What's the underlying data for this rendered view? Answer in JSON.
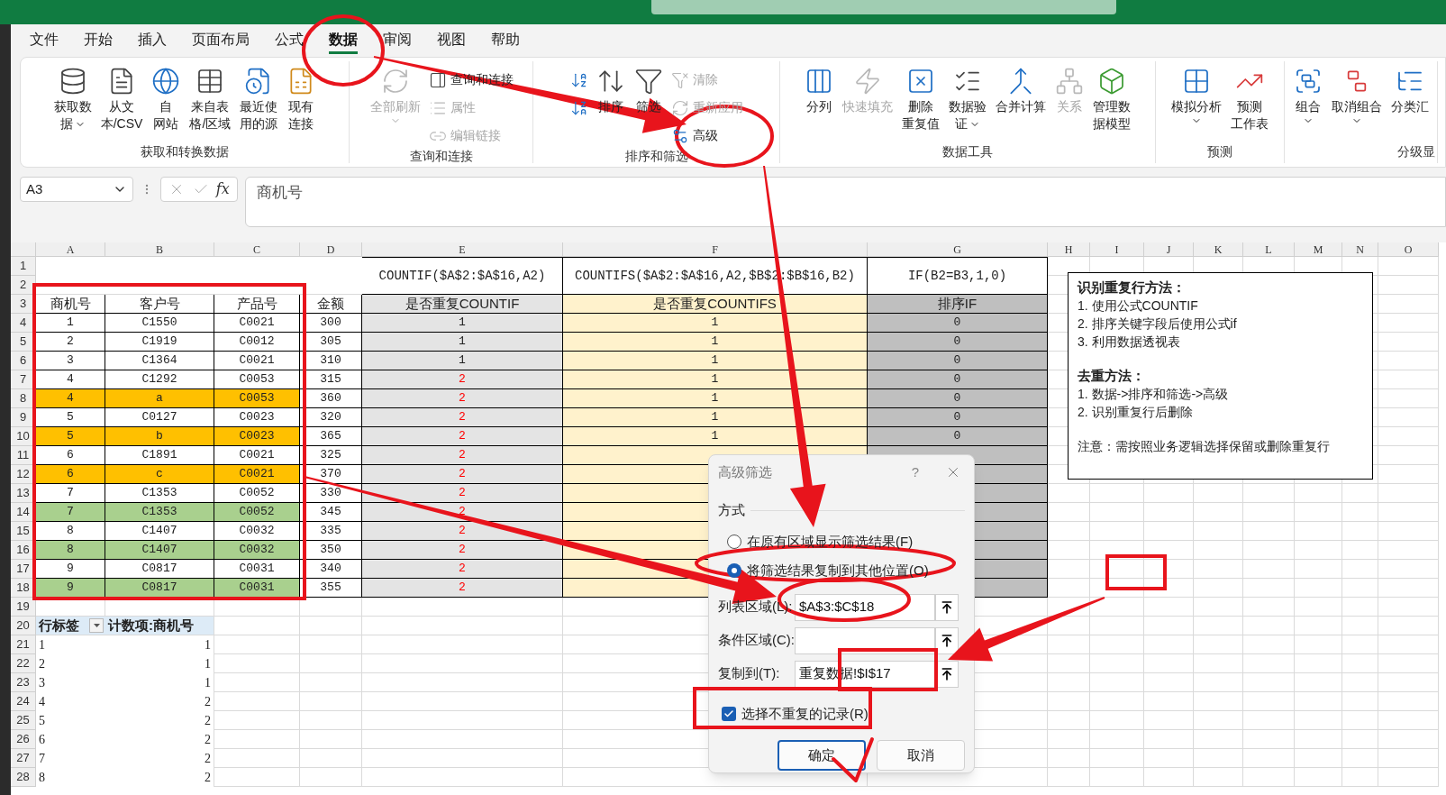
{
  "ribbon": {
    "tabs": [
      {
        "label": "文件",
        "selected": false
      },
      {
        "label": "开始",
        "selected": false
      },
      {
        "label": "插入",
        "selected": false
      },
      {
        "label": "页面布局",
        "selected": false
      },
      {
        "label": "公式",
        "selected": false
      },
      {
        "label": "数据",
        "selected": true
      },
      {
        "label": "审阅",
        "selected": false
      },
      {
        "label": "视图",
        "selected": false
      },
      {
        "label": "帮助",
        "selected": false
      }
    ],
    "groups": [
      {
        "label": "获取和转换数据",
        "items": [
          {
            "kind": "large",
            "lines": [
              "获取数",
              "据"
            ],
            "dropdown": true,
            "disabled": false
          },
          {
            "kind": "large",
            "lines": [
              "从文",
              "本/CSV"
            ],
            "disabled": false
          },
          {
            "kind": "large",
            "lines": [
              "自",
              "网站"
            ],
            "disabled": false
          },
          {
            "kind": "large",
            "lines": [
              "来自表",
              "格/区域"
            ],
            "disabled": false
          },
          {
            "kind": "large",
            "lines": [
              "最近使",
              "用的源"
            ],
            "disabled": false
          },
          {
            "kind": "large",
            "lines": [
              "现有",
              "连接"
            ],
            "disabled": false
          }
        ]
      },
      {
        "label": "查询和连接",
        "items": [
          {
            "kind": "large",
            "lines": [
              "全部刷新"
            ],
            "dropdown": true,
            "disabled": true
          },
          {
            "kind": "stack",
            "items": [
              {
                "label": "查询和连接",
                "disabled": false
              },
              {
                "label": "属性",
                "disabled": true
              },
              {
                "label": "编辑链接",
                "disabled": true
              }
            ]
          }
        ]
      },
      {
        "label": "排序和筛选",
        "items": [
          {
            "kind": "stack",
            "items": [
              {
                "disabled": false
              },
              {
                "disabled": false
              }
            ]
          },
          {
            "kind": "large",
            "lines": [
              "排序"
            ],
            "disabled": false
          },
          {
            "kind": "large",
            "lines": [
              "筛选"
            ],
            "disabled": false
          },
          {
            "kind": "stack",
            "items": [
              {
                "label": "清除",
                "disabled": true
              },
              {
                "label": "重新应用",
                "disabled": true
              },
              {
                "label": "高级",
                "disabled": false
              }
            ]
          }
        ]
      },
      {
        "label": "数据工具",
        "items": [
          {
            "kind": "large",
            "lines": [
              "分列"
            ],
            "disabled": false
          },
          {
            "kind": "large",
            "lines": [
              "快速填充"
            ],
            "disabled": true
          },
          {
            "kind": "large",
            "lines": [
              "删除",
              "重复值"
            ],
            "disabled": false
          },
          {
            "kind": "large",
            "lines": [
              "数据验",
              "证"
            ],
            "dropdown": true,
            "disabled": false
          },
          {
            "kind": "large",
            "lines": [
              "合并计算"
            ],
            "disabled": false
          },
          {
            "kind": "large",
            "lines": [
              "关系"
            ],
            "disabled": true
          },
          {
            "kind": "large",
            "lines": [
              "管理数",
              "据模型"
            ],
            "disabled": false
          }
        ]
      },
      {
        "label": "预测",
        "items": [
          {
            "kind": "large",
            "lines": [
              "模拟分析"
            ],
            "dropdown": true,
            "disabled": false
          },
          {
            "kind": "large",
            "lines": [
              "预测",
              "工作表"
            ],
            "disabled": false
          }
        ]
      },
      {
        "label": "分级显",
        "items": [
          {
            "kind": "large",
            "lines": [
              "组合"
            ],
            "dropdown": true,
            "disabled": false
          },
          {
            "kind": "large",
            "lines": [
              "取消组合"
            ],
            "dropdown": true,
            "disabled": false
          },
          {
            "kind": "large",
            "lines": [
              "分类汇"
            ],
            "disabled": false
          }
        ]
      }
    ]
  },
  "formula_bar": {
    "name_box": "A3",
    "fx": "fx",
    "formula": "商机号"
  },
  "sheet": {
    "columns": [
      "A",
      "B",
      "C",
      "D",
      "E",
      "F",
      "G",
      "H",
      "I",
      "J",
      "K",
      "L",
      "M",
      "N",
      "O"
    ],
    "row_numbers": [
      "1",
      "2",
      "3",
      "4",
      "5",
      "6",
      "7",
      "8",
      "9",
      "10",
      "11",
      "12",
      "13",
      "14",
      "15",
      "16",
      "17",
      "18",
      "19",
      "20",
      "21",
      "22",
      "23",
      "24",
      "25",
      "26",
      "27",
      "28"
    ],
    "formulas": [
      "COUNTIF($A$2:$A$16,A2)",
      "COUNTIFS($A$2:$A$16,A2,$B$2:$B$16,B2)",
      "IF(B2=B3,1,0)"
    ],
    "headers": [
      "商机号",
      "客户号",
      "产品号",
      "金额",
      "是否重复COUNTIF",
      "是否重复COUNTIFS",
      "排序IF"
    ],
    "rows": [
      {
        "a": "1",
        "b": "C1550",
        "c": "C0021",
        "d": "300",
        "e": "1",
        "f": "1",
        "g": "0",
        "flagged": false
      },
      {
        "a": "2",
        "b": "C1919",
        "c": "C0012",
        "d": "305",
        "e": "1",
        "f": "1",
        "g": "0",
        "flagged": false
      },
      {
        "a": "3",
        "b": "C1364",
        "c": "C0021",
        "d": "310",
        "e": "1",
        "f": "1",
        "g": "0",
        "flagged": false
      },
      {
        "a": "4",
        "b": "C1292",
        "c": "C0053",
        "d": "315",
        "e": "2",
        "f": "1",
        "g": "0",
        "flagged": true
      },
      {
        "a": "4",
        "b": "a",
        "c": "C0053",
        "d": "360",
        "e": "2",
        "f": "1",
        "g": "0",
        "flagged": true,
        "color": "#ffc000"
      },
      {
        "a": "5",
        "b": "C0127",
        "c": "C0023",
        "d": "320",
        "e": "2",
        "f": "1",
        "g": "0",
        "flagged": true
      },
      {
        "a": "5",
        "b": "b",
        "c": "C0023",
        "d": "365",
        "e": "2",
        "f": "1",
        "g": "0",
        "flagged": true,
        "color": "#ffc000"
      },
      {
        "a": "6",
        "b": "C1891",
        "c": "C0021",
        "d": "325",
        "e": "2",
        "flagged": true
      },
      {
        "a": "6",
        "b": "c",
        "c": "C0021",
        "d": "370",
        "e": "2",
        "flagged": true,
        "color": "#ffc000"
      },
      {
        "a": "7",
        "b": "C1353",
        "c": "C0052",
        "d": "330",
        "e": "2",
        "flagged": true
      },
      {
        "a": "7",
        "b": "C1353",
        "c": "C0052",
        "d": "345",
        "e": "2",
        "flagged": true,
        "color": "#a9d08e"
      },
      {
        "a": "8",
        "b": "C1407",
        "c": "C0032",
        "d": "335",
        "e": "2",
        "flagged": true
      },
      {
        "a": "8",
        "b": "C1407",
        "c": "C0032",
        "d": "350",
        "e": "2",
        "flagged": true,
        "color": "#a9d08e"
      },
      {
        "a": "9",
        "b": "C0817",
        "c": "C0031",
        "d": "340",
        "e": "2",
        "flagged": true
      },
      {
        "a": "9",
        "b": "C0817",
        "c": "C0031",
        "d": "355",
        "e": "2",
        "flagged": true,
        "color": "#a9d08e"
      }
    ],
    "pivot": {
      "header": [
        "行标签",
        "计数项:商机号"
      ],
      "rows": [
        {
          "label": "1",
          "count": "1"
        },
        {
          "label": "2",
          "count": "1"
        },
        {
          "label": "3",
          "count": "1"
        },
        {
          "label": "4",
          "count": "2"
        },
        {
          "label": "5",
          "count": "2"
        },
        {
          "label": "6",
          "count": "2"
        },
        {
          "label": "7",
          "count": "2"
        },
        {
          "label": "8",
          "count": "2"
        }
      ]
    }
  },
  "notes": [
    {
      "heading": "识别重复行方法：",
      "lines": [
        "1. 使用公式COUNTIF",
        "2. 排序关键字段后使用公式if",
        "3. 利用数据透视表"
      ]
    },
    {
      "heading": "去重方法：",
      "lines": [
        "1. 数据->排序和筛选->高级",
        "2. 识别重复行后删除"
      ]
    },
    {
      "lines": [
        "注意：需按照业务逻辑选择保留或删除重复行"
      ]
    }
  ],
  "dialog": {
    "title": "高级筛选",
    "help": "?",
    "section": "方式",
    "modes": [
      {
        "label": "在原有区域显示筛选结果(F)",
        "selected": false
      },
      {
        "label": "将筛选结果复制到其他位置(O)",
        "selected": true
      }
    ],
    "fields": [
      {
        "label": "列表区域(L):",
        "value": "$A$3:$C$18"
      },
      {
        "label": "条件区域(C):"
      },
      {
        "label": "复制到(T):",
        "value": "重复数据!$I$17"
      }
    ],
    "distinct": {
      "label": "选择不重复的记录(R)",
      "checked": true
    },
    "buttons": [
      {
        "label": "确定",
        "default": true
      },
      {
        "label": "取消",
        "default": false
      }
    ]
  }
}
